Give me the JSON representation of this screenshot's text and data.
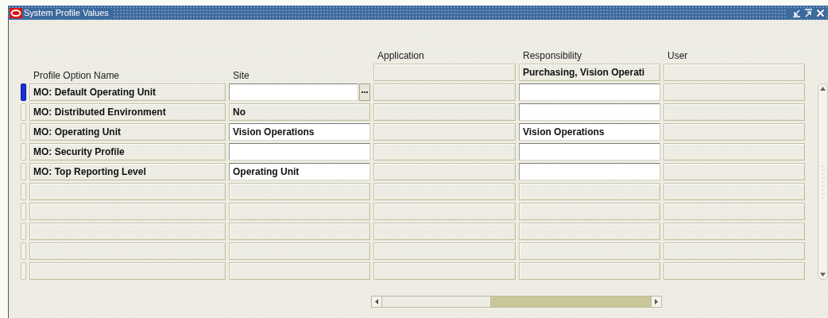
{
  "window": {
    "title": "System Profile Values"
  },
  "columns": [
    "Profile Option Name",
    "Site",
    "Application",
    "Responsibility",
    "User"
  ],
  "header_fields": [
    {
      "editable": false
    },
    {
      "value": "Purchasing, Vision Operati",
      "editable": false
    },
    {
      "editable": false
    }
  ],
  "rows": [
    {
      "selected": true,
      "cells": [
        {
          "value": "MO: Default Operating Unit",
          "editable": false
        },
        {
          "editable": true,
          "list_button": true
        },
        {
          "editable": false
        },
        {
          "editable": true
        },
        {
          "editable": false
        }
      ]
    },
    {
      "selected": false,
      "cells": [
        {
          "value": "MO: Distributed Environment",
          "editable": false
        },
        {
          "value": "No",
          "editable": false
        },
        {
          "editable": false
        },
        {
          "editable": true
        },
        {
          "editable": false
        }
      ]
    },
    {
      "selected": false,
      "cells": [
        {
          "value": "MO: Operating Unit",
          "editable": false
        },
        {
          "value": "Vision Operations",
          "editable": true
        },
        {
          "editable": false
        },
        {
          "value": "Vision Operations",
          "editable": true
        },
        {
          "editable": false
        }
      ]
    },
    {
      "selected": false,
      "cells": [
        {
          "value": "MO: Security Profile",
          "editable": false
        },
        {
          "editable": true
        },
        {
          "editable": false
        },
        {
          "editable": true
        },
        {
          "editable": false
        }
      ]
    },
    {
      "selected": false,
      "cells": [
        {
          "value": "MO: Top Reporting Level",
          "editable": false
        },
        {
          "value": "Operating Unit",
          "editable": true
        },
        {
          "editable": false
        },
        {
          "editable": true
        },
        {
          "editable": false
        }
      ]
    },
    {
      "selected": false,
      "cells": [
        {
          "editable": false
        },
        {
          "editable": false
        },
        {
          "editable": false
        },
        {
          "editable": false
        },
        {
          "editable": false
        }
      ]
    },
    {
      "selected": false,
      "cells": [
        {
          "editable": false
        },
        {
          "editable": false
        },
        {
          "editable": false
        },
        {
          "editable": false
        },
        {
          "editable": false
        }
      ]
    },
    {
      "selected": false,
      "cells": [
        {
          "editable": false
        },
        {
          "editable": false
        },
        {
          "editable": false
        },
        {
          "editable": false
        },
        {
          "editable": false
        }
      ]
    },
    {
      "selected": false,
      "cells": [
        {
          "editable": false
        },
        {
          "editable": false
        },
        {
          "editable": false
        },
        {
          "editable": false
        },
        {
          "editable": false
        }
      ]
    },
    {
      "selected": false,
      "cells": [
        {
          "editable": false
        },
        {
          "editable": false
        },
        {
          "editable": false
        },
        {
          "editable": false
        },
        {
          "editable": false
        }
      ]
    }
  ]
}
